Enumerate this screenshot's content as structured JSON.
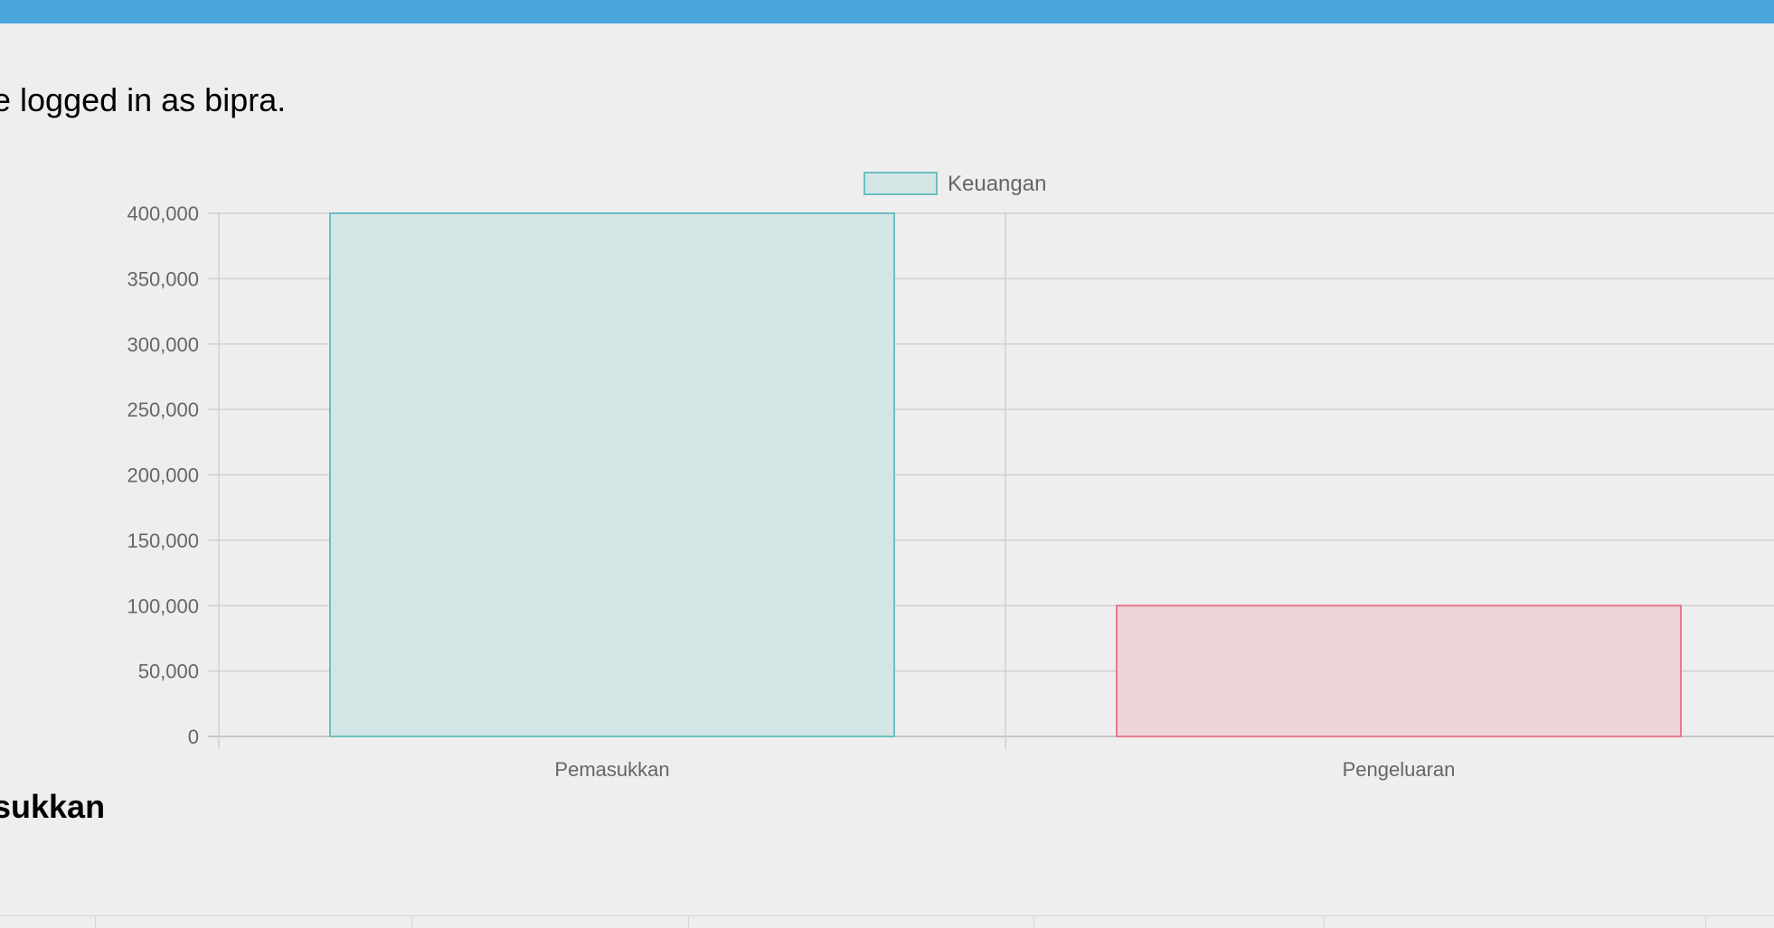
{
  "header": {
    "bar_color": "#4ba5dc"
  },
  "welcome_text": "e logged in as bipra.",
  "section_heading": "sukkan",
  "chart_data": {
    "type": "bar",
    "categories": [
      "Pemasukkan",
      "Pengeluaran"
    ],
    "series": [
      {
        "name": "Keuangan",
        "values": [
          400000,
          100000
        ],
        "fill_colors": [
          "#d4e5e5",
          "#eed5da"
        ],
        "border_colors": [
          "#6cc0bf",
          "#e8788f"
        ]
      }
    ],
    "y_ticks": [
      "0",
      "50,000",
      "100,000",
      "150,000",
      "200,000",
      "250,000",
      "300,000",
      "350,000",
      "400,000"
    ],
    "ylim": [
      0,
      400000
    ],
    "ystep": 50000,
    "legend_position": "top",
    "grid": true,
    "legend_swatch_fill": "#d4e5e5",
    "legend_swatch_border": "#6cc0bf",
    "grid_color": "#d0d0d0"
  }
}
